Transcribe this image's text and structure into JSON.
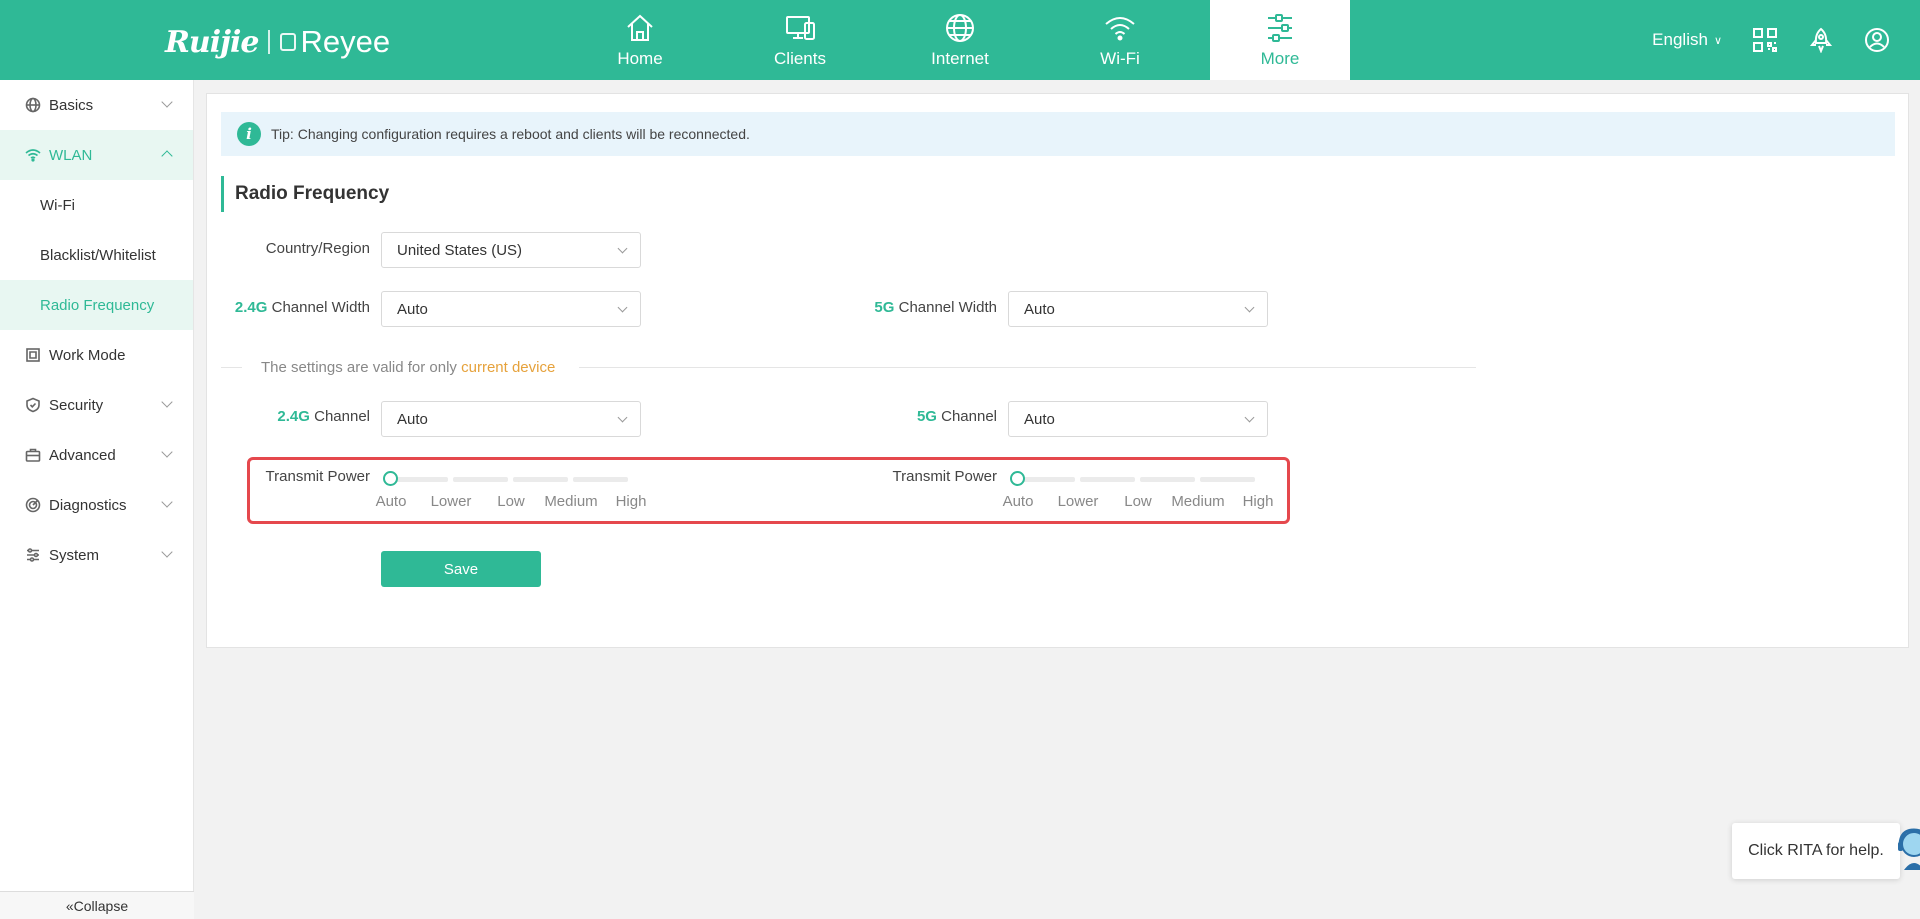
{
  "brand": {
    "logo1": "Ruijie",
    "logo2": "Reyee"
  },
  "nav": [
    {
      "label": "Home",
      "icon": "home-icon"
    },
    {
      "label": "Clients",
      "icon": "devices-icon"
    },
    {
      "label": "Internet",
      "icon": "globe-icon"
    },
    {
      "label": "Wi-Fi",
      "icon": "wifi-icon"
    },
    {
      "label": "More",
      "icon": "sliders-icon",
      "active": true
    }
  ],
  "header": {
    "language": "English"
  },
  "sidebar": {
    "items": [
      {
        "label": "Basics",
        "icon": "globe-icon"
      },
      {
        "label": "WLAN",
        "icon": "wifi-icon",
        "open": true
      },
      {
        "label": "Wi-Fi"
      },
      {
        "label": "Blacklist/Whitelist"
      },
      {
        "label": "Radio Frequency",
        "active": true
      },
      {
        "label": "Work Mode",
        "icon": "frame-icon"
      },
      {
        "label": "Security",
        "icon": "shield-icon"
      },
      {
        "label": "Advanced",
        "icon": "briefcase-icon"
      },
      {
        "label": "Diagnostics",
        "icon": "diagnostics-icon"
      },
      {
        "label": "System",
        "icon": "settings-sliders-icon"
      }
    ],
    "collapse": "Collapse"
  },
  "main": {
    "tip": "Tip: Changing configuration requires a reboot and clients will be reconnected.",
    "title": "Radio Frequency",
    "country_label": "Country/Region",
    "country_value": "United States (US)",
    "width24_band": "2.4G",
    "width24_label": " Channel Width",
    "width24_value": "Auto",
    "width5_band": "5G",
    "width5_label": " Channel Width",
    "width5_value": "Auto",
    "divider_text": "The settings are valid for only ",
    "divider_accent": "current device",
    "channel24_band": "2.4G",
    "channel24_label": " Channel",
    "channel24_value": "Auto",
    "channel5_band": "5G",
    "channel5_label": " Channel",
    "channel5_value": "Auto",
    "power24_label": "Transmit Power",
    "power5_label": "Transmit Power",
    "power_levels": [
      "Auto",
      "Lower",
      "Low",
      "Medium",
      "High"
    ],
    "power24_selected": "Auto",
    "power5_selected": "Auto",
    "save": "Save"
  },
  "rita": "Click RITA for help.",
  "colors": {
    "accent": "#2fb996",
    "highlight": "#e5484d",
    "warning": "#e6a23c"
  }
}
